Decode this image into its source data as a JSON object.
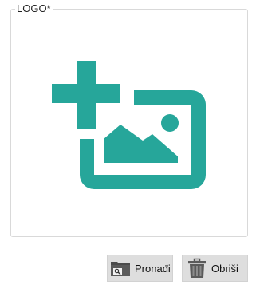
{
  "logo_field": {
    "legend": "LOGO*",
    "placeholder_icon": "add-photo-icon",
    "accent_color": "#26a69a"
  },
  "actions": {
    "find_label": "Pronađi",
    "find_icon": "folder-search-icon",
    "delete_label": "Obriši",
    "delete_icon": "trash-icon"
  }
}
